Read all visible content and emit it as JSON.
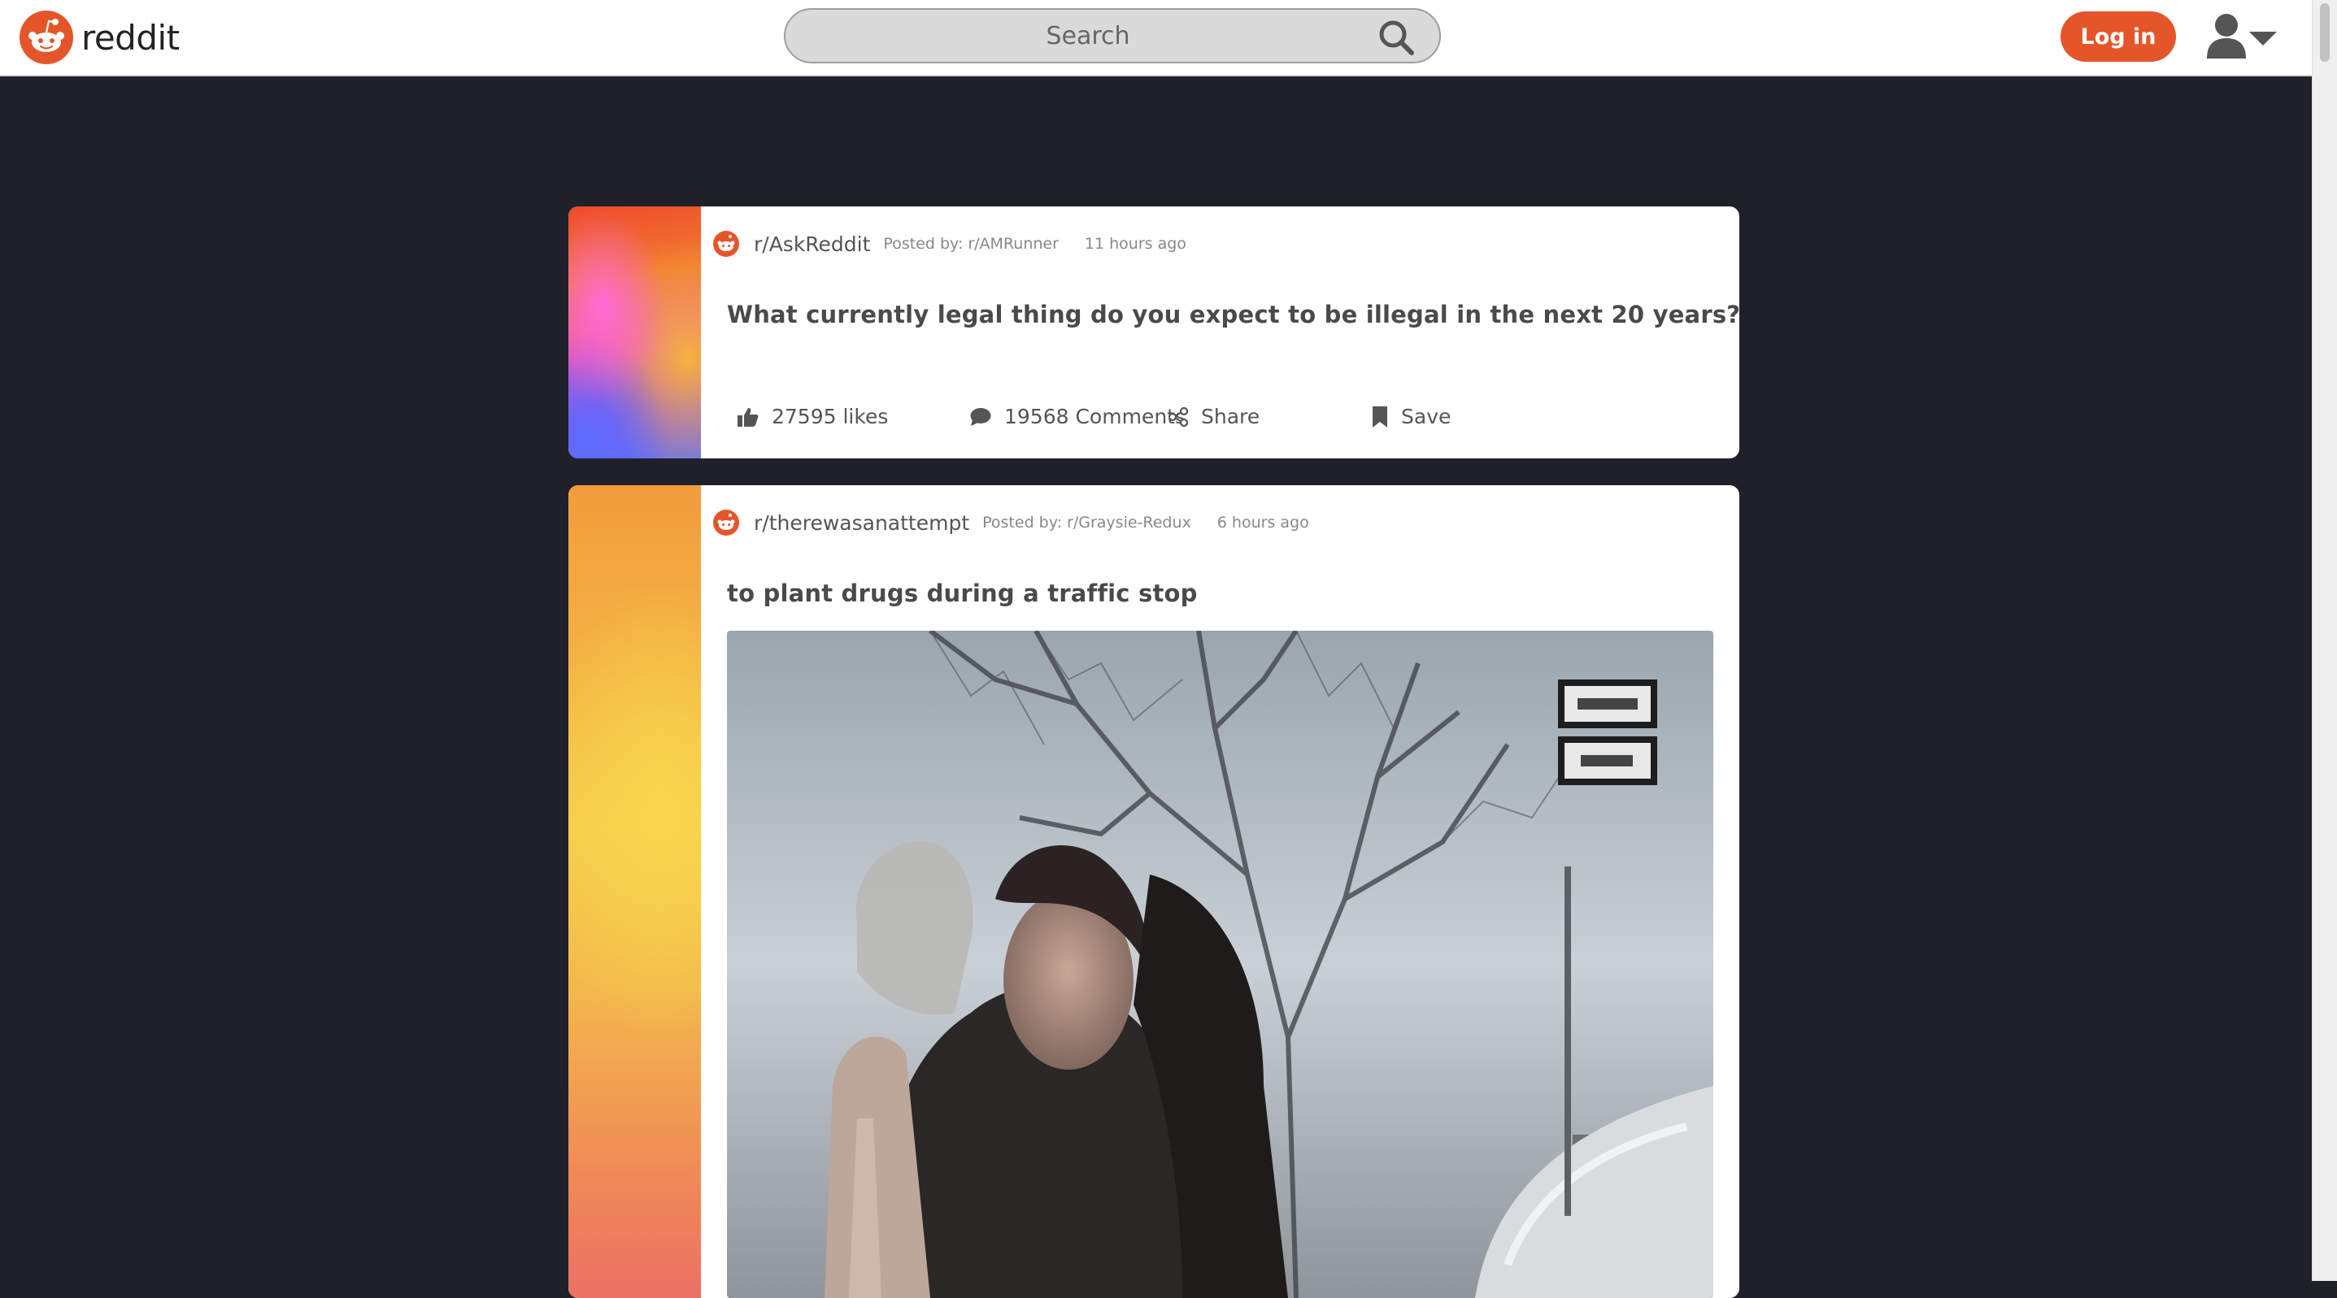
{
  "header": {
    "logo_text": "reddit",
    "search_placeholder": "Search",
    "login_label": "Log in",
    "user_menu_icon": "user-dropdown-icon"
  },
  "posts": [
    {
      "subreddit": "r/AskReddit",
      "posted_by": "Posted by: r/AMRunner",
      "time": "11 hours ago",
      "title": "What currently legal thing do you expect to be illegal in the next 20 years?",
      "likes": "27595 likes",
      "comments": "19568 Comments",
      "share": "Share",
      "save": "Save"
    },
    {
      "subreddit": "r/therewasanattempt",
      "posted_by": "Posted by: r/Graysie-Redux",
      "time": "6 hours ago",
      "title": "to plant drugs during a traffic stop",
      "media": "video-still"
    }
  ],
  "colors": {
    "brand": "#e4562a",
    "page_bg": "#1f2029",
    "card_bg": "#ffffff",
    "text": "#4a4a4a"
  }
}
